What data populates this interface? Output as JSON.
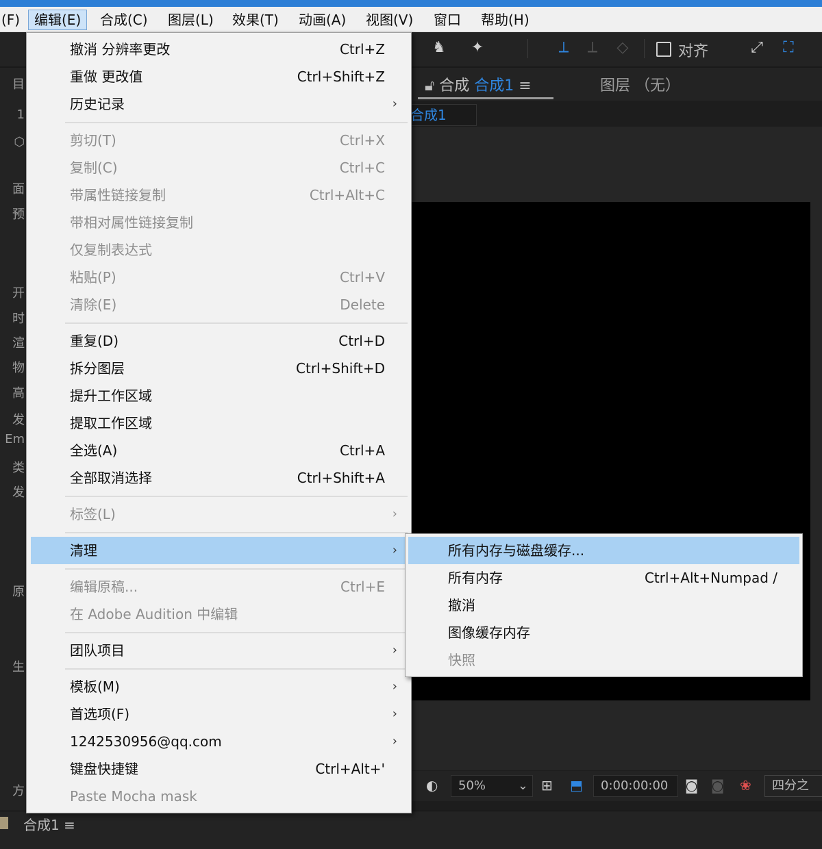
{
  "menubar": {
    "items": [
      "(F)",
      "编辑(E)",
      "合成(C)",
      "图层(L)",
      "效果(T)",
      "动画(A)",
      "视图(V)",
      "窗口",
      "帮助(H)"
    ]
  },
  "toolbar": {
    "align_label": "对齐"
  },
  "left_panel": {
    "labels": [
      "目",
      "1",
      "面",
      "预",
      "开",
      "时",
      "渲",
      "物",
      "高",
      "发",
      "Em",
      "类",
      "发",
      "原",
      "生",
      "方"
    ]
  },
  "comp_panel": {
    "tab_prefix": "合成",
    "tab_name": "合成1",
    "layer_tab": "图层 （无）",
    "breadcrumb": "合成1"
  },
  "viewer_bar": {
    "zoom": "50%",
    "timecode": "0:00:00:00",
    "view_layout": "四分之"
  },
  "timeline": {
    "tab": "合成1"
  },
  "edit_menu": {
    "undo": {
      "label": "撤消 分辨率更改",
      "shortcut": "Ctrl+Z"
    },
    "redo": {
      "label": "重做 更改值",
      "shortcut": "Ctrl+Shift+Z"
    },
    "history": {
      "label": "历史记录"
    },
    "cut": {
      "label": "剪切(T)",
      "shortcut": "Ctrl+X"
    },
    "copy": {
      "label": "复制(C)",
      "shortcut": "Ctrl+C"
    },
    "copy_with_links": {
      "label": "带属性链接复制",
      "shortcut": "Ctrl+Alt+C"
    },
    "copy_relative_links": {
      "label": "带相对属性链接复制"
    },
    "copy_expression": {
      "label": "仅复制表达式"
    },
    "paste": {
      "label": "粘贴(P)",
      "shortcut": "Ctrl+V"
    },
    "clear": {
      "label": "清除(E)",
      "shortcut": "Delete"
    },
    "duplicate": {
      "label": "重复(D)",
      "shortcut": "Ctrl+D"
    },
    "split_layer": {
      "label": "拆分图层",
      "shortcut": "Ctrl+Shift+D"
    },
    "lift_work_area": {
      "label": "提升工作区域"
    },
    "extract_work_area": {
      "label": "提取工作区域"
    },
    "select_all": {
      "label": "全选(A)",
      "shortcut": "Ctrl+A"
    },
    "deselect_all": {
      "label": "全部取消选择",
      "shortcut": "Ctrl+Shift+A"
    },
    "label_menu": {
      "label": "标签(L)"
    },
    "purge": {
      "label": "清理"
    },
    "edit_original": {
      "label": "编辑原稿...",
      "shortcut": "Ctrl+E"
    },
    "edit_in_audition": {
      "label": "在 Adobe Audition 中编辑"
    },
    "team_project": {
      "label": "团队项目"
    },
    "templates": {
      "label": "模板(M)"
    },
    "preferences": {
      "label": "首选项(F)"
    },
    "account": {
      "label": "1242530956@qq.com"
    },
    "keyboard_shortcuts": {
      "label": "键盘快捷键",
      "shortcut": "Ctrl+Alt+'"
    },
    "paste_mocha": {
      "label": "Paste Mocha mask"
    }
  },
  "purge_submenu": {
    "all_memory_disk_cache": {
      "label": "所有内存与磁盘缓存..."
    },
    "all_memory": {
      "label": "所有内存",
      "shortcut": "Ctrl+Alt+Numpad /"
    },
    "undo": {
      "label": "撤消"
    },
    "image_cache_memory": {
      "label": "图像缓存内存"
    },
    "snapshot": {
      "label": "快照"
    }
  },
  "arrow_glyph": "›"
}
